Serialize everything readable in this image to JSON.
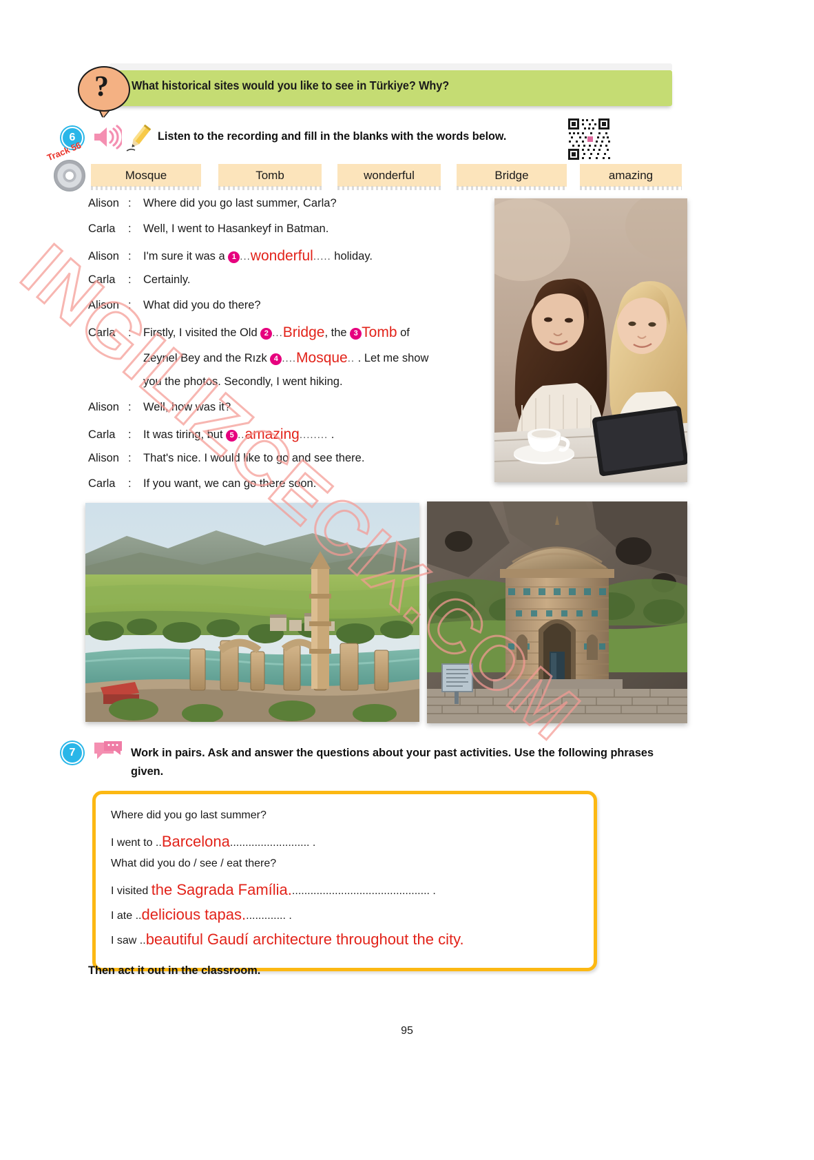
{
  "page": {
    "number": "95"
  },
  "question_banner": {
    "icon": "question-mark",
    "text": "What historical sites would you like to see in Türkiye? Why?"
  },
  "exercise6": {
    "number": "6",
    "instruction": "Listen to the recording and fill in the blanks with the words below.",
    "track_label": "Track 56",
    "word_bank": [
      "Mosque",
      "Tomb",
      "wonderful",
      "Bridge",
      "amazing"
    ],
    "dialogue": [
      {
        "speaker": "Alison",
        "colon": ":",
        "segments": [
          {
            "type": "text",
            "value": "Where did you go last summer, Carla?"
          }
        ]
      },
      {
        "speaker": "Carla",
        "colon": ":",
        "segments": [
          {
            "type": "text",
            "value": "Well, I went to Hasankeyf in Batman."
          }
        ]
      },
      {
        "speaker": "Alison",
        "colon": ":",
        "segments": [
          {
            "type": "text",
            "value": "I'm sure it was a "
          },
          {
            "type": "blank",
            "num": "1",
            "answer": "wonderful"
          },
          {
            "type": "text",
            "value": " holiday."
          }
        ]
      },
      {
        "speaker": "Carla",
        "colon": ":",
        "segments": [
          {
            "type": "text",
            "value": "Certainly."
          }
        ]
      },
      {
        "speaker": "Alison",
        "colon": ":",
        "segments": [
          {
            "type": "text",
            "value": "What did you do there?"
          }
        ]
      },
      {
        "speaker": "Carla",
        "colon": ":",
        "segments": [
          {
            "type": "text",
            "value": "Firstly,  I  visited  the  Old  "
          },
          {
            "type": "blank",
            "num": "2",
            "answer": "Bridge"
          },
          {
            "type": "text",
            "value": ", the "
          },
          {
            "type": "blank",
            "num": "3",
            "answer": "Tomb"
          },
          {
            "type": "text",
            "value": " of"
          }
        ]
      },
      {
        "speaker": "",
        "colon": "",
        "continuation": true,
        "segments": [
          {
            "type": "text",
            "value": "Zeynel Bey and the Rızk "
          },
          {
            "type": "blank",
            "num": "4",
            "answer": "Mosque"
          },
          {
            "type": "text",
            "value": " . Let me show"
          }
        ]
      },
      {
        "speaker": "",
        "colon": "",
        "continuation": true,
        "segments": [
          {
            "type": "text",
            "value": "you the photos. Secondly, I went hiking."
          }
        ]
      },
      {
        "speaker": "Alison",
        "colon": ":",
        "segments": [
          {
            "type": "text",
            "value": "Well, how was it?"
          }
        ]
      },
      {
        "speaker": "Carla",
        "colon": ":",
        "segments": [
          {
            "type": "text",
            "value": "It was tiring, but "
          },
          {
            "type": "blank",
            "num": "5",
            "answer": "amazing"
          },
          {
            "type": "text",
            "value": " ."
          }
        ]
      },
      {
        "speaker": "Alison",
        "colon": ":",
        "segments": [
          {
            "type": "text",
            "value": "That's nice. I would like to go and see there."
          }
        ]
      },
      {
        "speaker": "Carla",
        "colon": ":",
        "segments": [
          {
            "type": "text",
            "value": "If you want, we can go there soon."
          }
        ]
      }
    ],
    "photos": [
      {
        "name": "girls-with-tablet",
        "alt": "Two young women looking at a tablet at a cafe table"
      },
      {
        "name": "hasankeyf-landscape",
        "alt": "Hasankeyf ruins and minaret beside the Tigris river"
      },
      {
        "name": "zeynel-bey-tomb",
        "alt": "Tomb of Zeynel Bey, a cylindrical brick mausoleum"
      }
    ]
  },
  "exercise7": {
    "number": "7",
    "instruction": "Work in pairs. Ask and answer the questions about your past activities. Use the following phrases given.",
    "box_lines": [
      {
        "prompt": "Where did you go last summer?",
        "answer": "",
        "trailing": ""
      },
      {
        "prompt": "I went to ..",
        "answer": "Barcelona",
        "trailing": ".......................... ."
      },
      {
        "prompt": "What did you do / see / eat there?",
        "answer": "",
        "trailing": ""
      },
      {
        "prompt": "I visited ",
        "answer": "the Sagrada Família.",
        "trailing": "............................................. ."
      },
      {
        "prompt": "I ate ..",
        "answer": "delicious tapas.",
        "trailing": "............. ."
      },
      {
        "prompt": "I saw ..",
        "answer": "beautiful Gaudí architecture throughout the city.",
        "trailing": ""
      }
    ],
    "closing": "Then act it out in the classroom."
  },
  "watermark": {
    "text": "INGILIZCECIX.COM",
    "color": "#f59a94"
  },
  "colors": {
    "banner_green": "#c5dc73",
    "question_orange": "#f4b183",
    "number_blue": "#29b6e8",
    "wordchip_tan": "#fce4bb",
    "answer_red": "#e2231a",
    "bullet_magenta": "#e6007e",
    "box_yellow": "#fcb813",
    "speaker_pink": "#f48fb1"
  }
}
